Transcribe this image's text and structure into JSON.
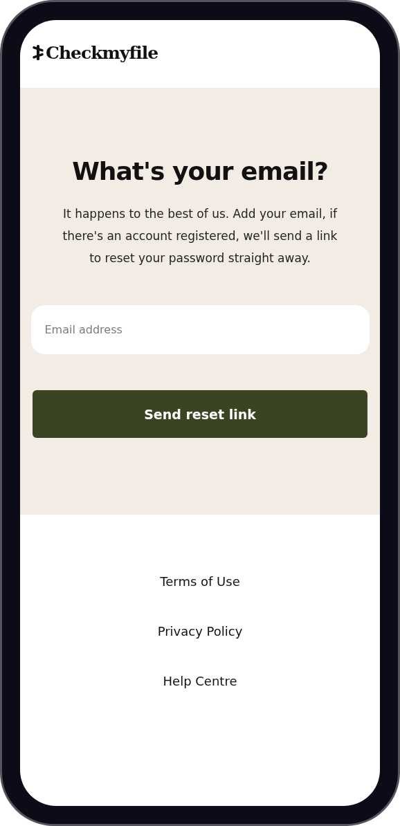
{
  "logo": {
    "text": "Checkmyfile"
  },
  "heading": "What's your email?",
  "intro": "It happens to the best of us. Add your email, if there's an account registered, we'll send a link to reset your password straight away.",
  "email_field": {
    "placeholder": "Email address"
  },
  "submit_button": "Send reset link",
  "footer_links": [
    "Terms of Use",
    "Privacy Policy",
    "Help Centre"
  ]
}
